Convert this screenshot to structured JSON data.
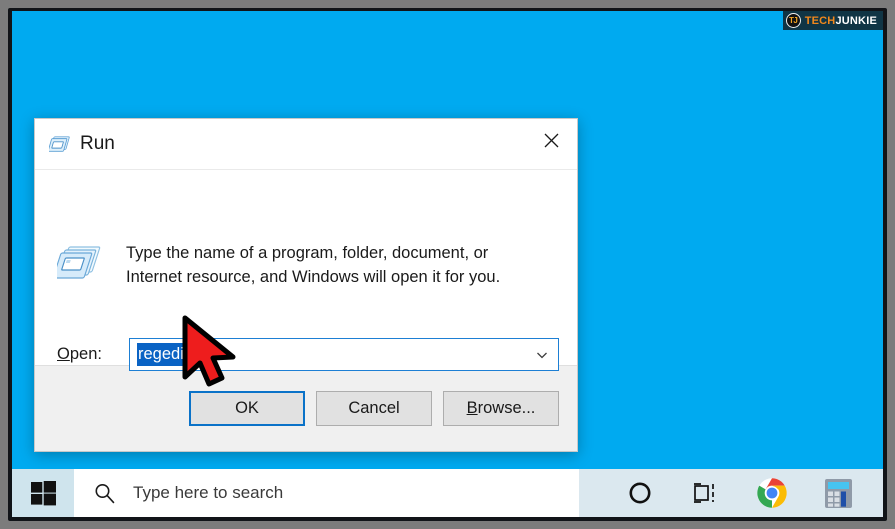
{
  "watermark": {
    "logo_text": "TJ",
    "brand_first": "TECH",
    "brand_second": "JUNKIE"
  },
  "desktop": {
    "background_color": "#00aaf0"
  },
  "run_dialog": {
    "title": "Run",
    "title_icon": "run-window-icon",
    "close_label": "✕",
    "description": "Type the name of a program, folder, document, or Internet resource, and Windows will open it for you.",
    "description_icon": "run-window-icon",
    "open_label_prefix": "O",
    "open_label_rest": "pen:",
    "open_value": "regedit",
    "open_value_selected": true,
    "combo_arrow_icon": "chevron-down-icon",
    "buttons": {
      "ok": "OK",
      "cancel": "Cancel",
      "browse_prefix": "B",
      "browse_rest": "rowse..."
    },
    "accent_color": "#0a72c8",
    "selection_color": "#0a63c4"
  },
  "cursor": {
    "icon": "red-arrow-pointer",
    "fill_color": "#ee1d1d"
  },
  "taskbar": {
    "background_color": "#dbe8ef",
    "start_icon": "windows-logo-icon",
    "search_icon": "search-icon",
    "search_placeholder": "Type here to search",
    "tray": [
      {
        "name": "cortana-icon",
        "label": "Cortana"
      },
      {
        "name": "task-view-icon",
        "label": "Task View"
      },
      {
        "name": "chrome-icon",
        "label": "Google Chrome"
      },
      {
        "name": "calculator-icon",
        "label": "Calculator"
      }
    ]
  }
}
